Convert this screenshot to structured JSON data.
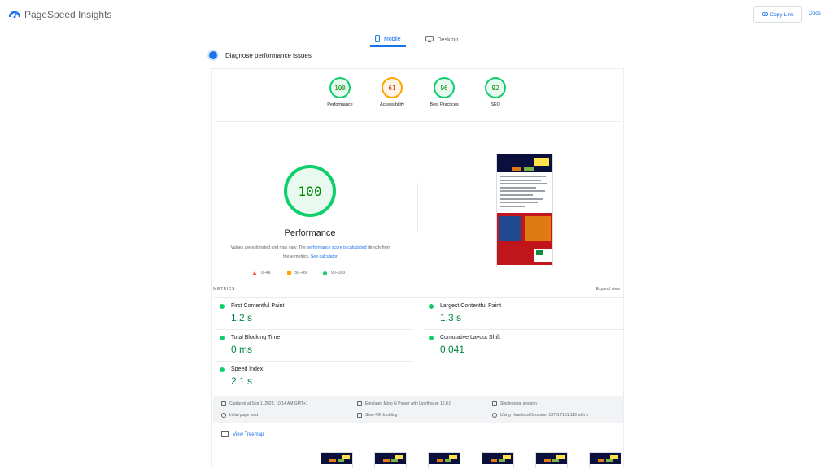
{
  "header": {
    "app_title": "PageSpeed Insights",
    "copy_link_label": "Copy Link",
    "docs_label": "Docs"
  },
  "tabs": [
    {
      "label": "Mobile",
      "active": true
    },
    {
      "label": "Desktop",
      "active": false
    }
  ],
  "diagnose_label": "Diagnose performance issues",
  "category_scores": [
    {
      "score": "100",
      "label": "Performance",
      "color": "#0cce6b"
    },
    {
      "score": "61",
      "label": "Accessibility",
      "color": "#ffa400"
    },
    {
      "score": "96",
      "label": "Best Practices",
      "color": "#0cce6b"
    },
    {
      "score": "92",
      "label": "SEO",
      "color": "#0cce6b"
    }
  ],
  "performance": {
    "score": "100",
    "title": "Performance",
    "note_prefix": "Values are estimated and may vary. The ",
    "note_link1": "performance score is calculated",
    "note_middle": " directly from these metrics. ",
    "note_link2": "See calculator."
  },
  "legend": [
    {
      "range": "0–49",
      "shape": "triangle",
      "color": "#ff4e42"
    },
    {
      "range": "50–89",
      "shape": "square",
      "color": "#ffa400"
    },
    {
      "range": "90–100",
      "shape": "circle",
      "color": "#0cce6b"
    }
  ],
  "metrics": {
    "heading": "METRICS",
    "expand_label": "Expand view",
    "items": [
      {
        "name": "First Contentful Paint",
        "value": "1.2 s"
      },
      {
        "name": "Largest Contentful Paint",
        "value": "1.3 s"
      },
      {
        "name": "Total Blocking Time",
        "value": "0 ms"
      },
      {
        "name": "Cumulative Layout Shift",
        "value": "0.041"
      },
      {
        "name": "Speed Index",
        "value": "2.1 s"
      }
    ]
  },
  "run_info": {
    "captured": "Captured at Sep 1, 2025, 10:14 AM GMT+1",
    "emulated": "Emulated Moto G Power with Lighthouse 12.8.0",
    "session": "Single page session",
    "load": "Initial page load",
    "throttling": "Slow 4G throttling",
    "browser": "Using HeadlessChromium 137.0.7151.119 with lr"
  },
  "treemap_label": "View Treemap",
  "colors": {
    "accent": "#1a73e8",
    "pass": "#0cce6b",
    "average": "#ffa400",
    "fail": "#ff4e42"
  }
}
